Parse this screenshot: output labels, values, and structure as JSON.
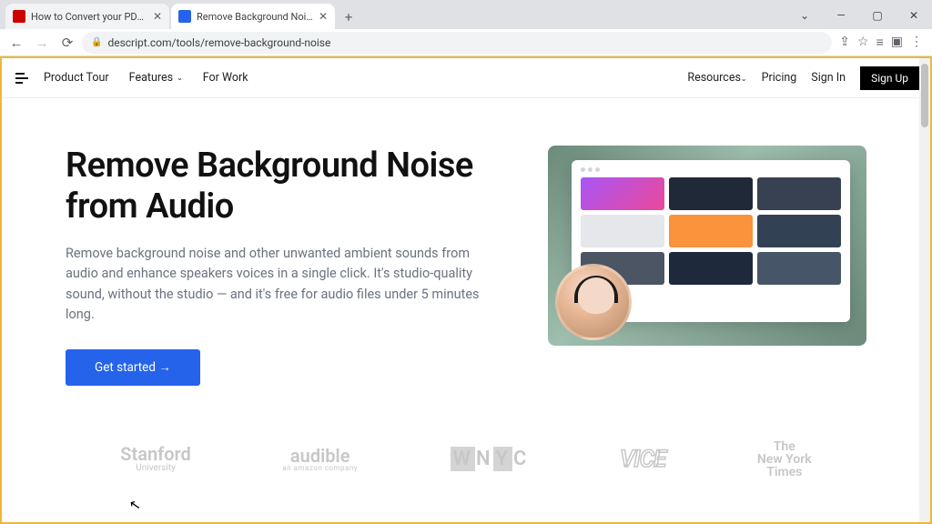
{
  "browser": {
    "tabs": [
      {
        "label": "How to Convert your PDF file to...",
        "favicon": "#cc0000"
      },
      {
        "label": "Remove Background Noise from...",
        "favicon": "#2563eb"
      }
    ],
    "newtab_glyph": "+",
    "window": {
      "min": "—",
      "max": "▢",
      "close": "✕",
      "down": "⌄"
    },
    "nav": {
      "back": "←",
      "forward": "→",
      "reload": "⟳"
    },
    "url": "descript.com/tools/remove-background-noise",
    "lock_glyph": "🔒",
    "right_icons": [
      "⇪",
      "☆",
      "≡",
      "▣",
      "⋮"
    ]
  },
  "site": {
    "nav": {
      "left": [
        "Product Tour",
        "Features",
        "For Work"
      ],
      "features_chevron": "⌄",
      "right": [
        "Resources",
        "Pricing",
        "Sign In"
      ],
      "resources_chevron": "⌄",
      "signup": "Sign Up"
    },
    "hero": {
      "title": "Remove Background Noise from Audio",
      "desc": "Remove background noise and other unwanted ambient sounds from audio and enhance speakers voices in a single click. It's studio-quality sound, without the studio — and it's free for audio files under 5 minutes long.",
      "cta": "Get started →"
    },
    "logos": {
      "stanford": "Stanford",
      "stanford_sub": "University",
      "audible": "audible",
      "audible_sub": "an amazon company",
      "wnyc_w": "W",
      "wnyc_n": "N",
      "wnyc_y": "Y",
      "wnyc_c": "C",
      "vice": "VICE",
      "nyt1": "The",
      "nyt2": "New York",
      "nyt3": "Times"
    }
  },
  "cursor_glyph": "↖"
}
